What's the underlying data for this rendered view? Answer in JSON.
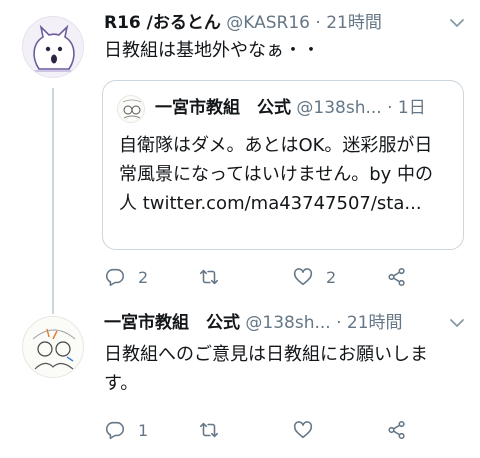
{
  "tweet1": {
    "name": "R16 /おるとん",
    "handle": "@KASR16",
    "time": "21時間",
    "text": "日教組は基地外やなぁ・・",
    "quote": {
      "name": "一宮市教組　公式",
      "handle": "@138sh...",
      "time": "1日",
      "text": "自衛隊はダメ。あとはOK。迷彩服が日常風景になってはいけません。by 中の人 twitter.com/ma43747507/sta..."
    },
    "replies": "2",
    "retweets": "",
    "likes": "2"
  },
  "tweet2": {
    "name": "一宮市教組　公式",
    "handle": "@138sh...",
    "time": "21時間",
    "text": "日教組へのご意見は日教組にお願いします。",
    "replies": "1",
    "retweets": "",
    "likes": ""
  },
  "separator": " · ",
  "icons": {
    "reply": "reply-icon",
    "retweet": "retweet-icon",
    "like": "heart-icon",
    "share": "share-icon",
    "caret": "chevron-down-icon"
  },
  "colors": {
    "text": "#14171a",
    "secondary": "#657786",
    "border": "#ccd6dd"
  }
}
